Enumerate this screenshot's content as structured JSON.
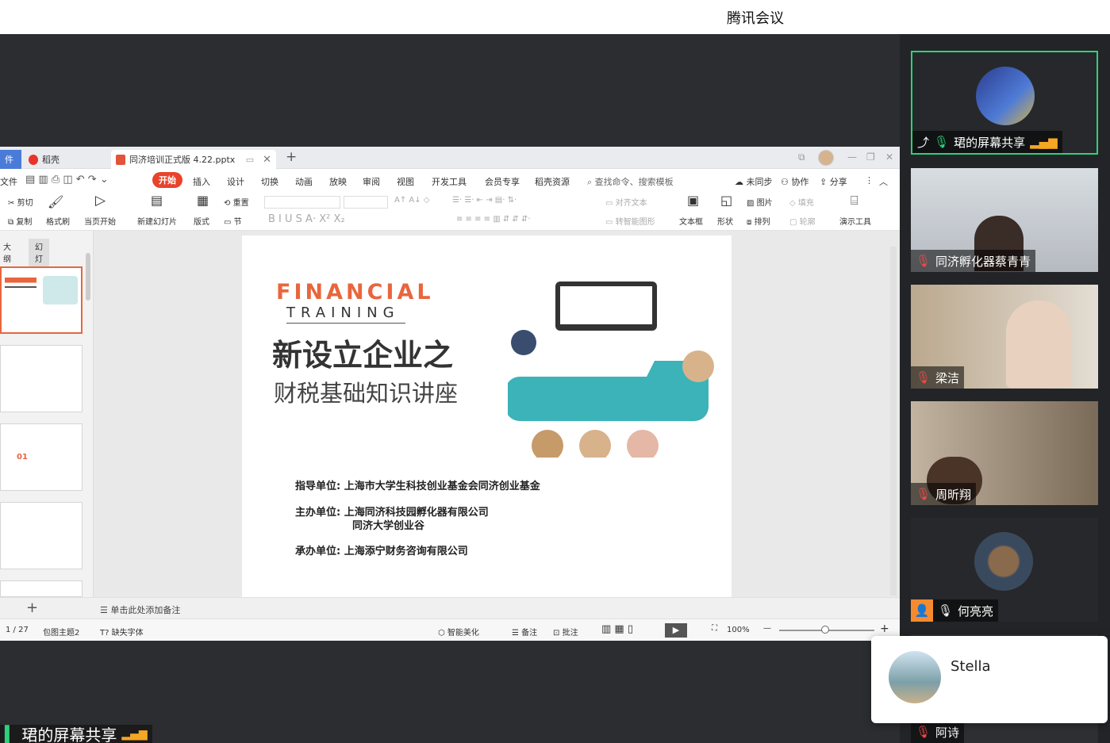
{
  "app": {
    "title": "腾讯会议"
  },
  "wps": {
    "tabs": {
      "home": "稻壳",
      "doc": "同济培训正式版 4.22.pptx",
      "prev": "件"
    },
    "menu": [
      "开始",
      "插入",
      "设计",
      "切换",
      "动画",
      "放映",
      "审阅",
      "视图",
      "开发工具",
      "会员专享",
      "稻壳资源"
    ],
    "search": "查找命令、搜索模板",
    "right": {
      "sync": "未同步",
      "collab": "协作",
      "share": "分享"
    },
    "ribbon": {
      "cut": "剪切",
      "copy": "复制",
      "painter": "格式刷",
      "play": "当页开始",
      "newslide": "新建幻灯片",
      "layout": "版式",
      "reset": "重置",
      "section": "节",
      "textbox": "文本框",
      "shape": "形状",
      "picture": "图片",
      "arrange": "排列",
      "fill": "填充",
      "outline": "轮廓",
      "present": "演示工具",
      "align_text": "对齐文本",
      "smart": "转智能图形"
    },
    "pane_tabs": {
      "outline": "大纲",
      "slides": "幻灯片"
    },
    "notes": "单击此处添加备注",
    "status": {
      "page": "1 / 27",
      "theme": "包图主题2",
      "font": "缺失字体",
      "beautify": "智能美化",
      "comment_notes": "备注",
      "comment": "批注",
      "zoom": "100%"
    }
  },
  "slide": {
    "title_en1": "FINANCIAL",
    "title_en2": "TRAINING",
    "title_cn1": "新设立企业之",
    "title_cn2": "财税基础知识讲座",
    "lines": [
      {
        "label": "指导单位:",
        "value": "上海市大学生科技创业基金会同济创业基金"
      },
      {
        "label": "主办单位:",
        "value": "上海同济科技园孵化器有限公司"
      },
      {
        "label": "",
        "value": "同济大学创业谷"
      },
      {
        "label": "承办单位:",
        "value": "上海添宁财务咨询有限公司"
      }
    ]
  },
  "participants": [
    {
      "name": "珺的屏幕共享"
    },
    {
      "name": "同济孵化器蔡青青"
    },
    {
      "name": "梁洁"
    },
    {
      "name": "周昕翔"
    },
    {
      "name": "何亮亮"
    },
    {
      "name": "阿诗"
    }
  ],
  "popup": {
    "name": "Stella"
  },
  "bottom_share": "珺的屏幕共享"
}
